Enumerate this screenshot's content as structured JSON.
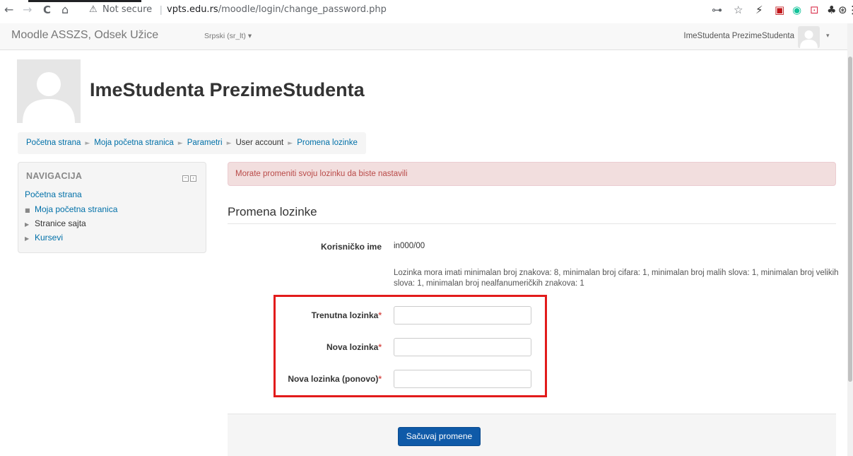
{
  "browser": {
    "nav_icons": [
      "←",
      "→",
      "C",
      "⌂"
    ],
    "security_icon": "⚠",
    "security_text": "Not secure",
    "url_host": "vpts.edu.rs",
    "url_path": "/moodle/login/change_password.php",
    "toolbar_icons": [
      "⊶",
      "☆",
      "⚡",
      "▣",
      "◉",
      "⊡",
      "♣",
      "⊛",
      "⋮"
    ]
  },
  "navbar": {
    "site_name": "Moodle ASSZS, Odsek Užice",
    "language": "Srpski (sr_lt) ▾",
    "user_name": "ImeStudenta PrezimeStudenta",
    "caret": "▾"
  },
  "header": {
    "full_name": "ImeStudenta PrezimeStudenta"
  },
  "breadcrumb": {
    "items": [
      "Početna strana",
      "Moja početna stranica",
      "Parametri",
      "User account",
      "Promena lozinke"
    ],
    "separator": "►"
  },
  "sidebar": {
    "title": "NAVIGACIJA",
    "home": "Početna strana",
    "items": [
      {
        "marker": "■",
        "label": "Moja početna stranica"
      },
      {
        "marker": "▶",
        "label": "Stranice sajta"
      },
      {
        "marker": "▶",
        "label": "Kursevi"
      }
    ]
  },
  "alert": {
    "message": "Morate promeniti svoju lozinku da biste nastavili"
  },
  "form": {
    "legend": "Promena lozinke",
    "username_label": "Korisničko ime",
    "username_value": "in000/00",
    "policy": "Lozinka mora imati minimalan broj znakova: 8, minimalan broj cifara: 1, minimalan broj malih slova: 1, minimalan broj velikih slova: 1, minimalan broj nealfanumeričkih znakova: 1",
    "required_mark": "*",
    "fields": [
      {
        "label": "Trenutna lozinka",
        "value": ""
      },
      {
        "label": "Nova lozinka",
        "value": ""
      },
      {
        "label": "Nova lozinka (ponovo)",
        "value": ""
      }
    ],
    "submit_label": "Sačuvaj promene"
  },
  "colors": {
    "link": "#0070a8",
    "alert_bg": "#f2dede",
    "alert_text": "#b94a48",
    "required": "#d9534f",
    "submit_bg": "#0f5aa8",
    "highlight": "#e21b1b"
  }
}
